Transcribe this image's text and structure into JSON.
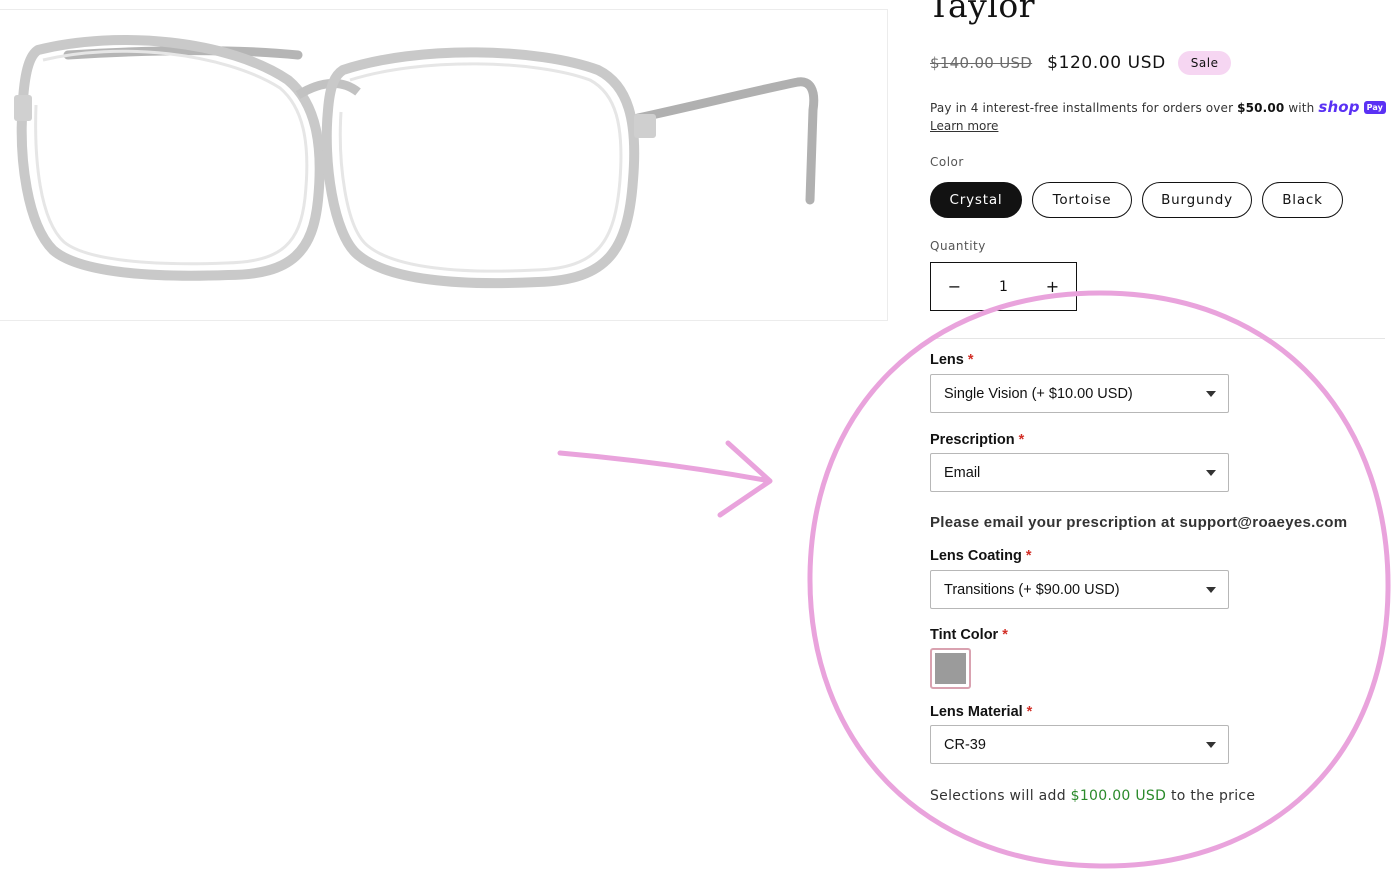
{
  "product": {
    "title": "Taylor",
    "price_original": "$140.00 USD",
    "price_sale": "$120.00 USD",
    "sale_badge": "Sale"
  },
  "installments": {
    "text_before": "Pay in 4 interest-free installments for orders over ",
    "threshold": "$50.00",
    "text_with": " with ",
    "brand": "shop",
    "brand_badge": "Pay",
    "learn_more": "Learn more"
  },
  "color": {
    "label": "Color",
    "options": [
      "Crystal",
      "Tortoise",
      "Burgundy",
      "Black"
    ],
    "selected": "Crystal"
  },
  "quantity": {
    "label": "Quantity",
    "value": "1",
    "minus": "−",
    "plus": "+"
  },
  "options": {
    "lens": {
      "label": "Lens",
      "required": "*",
      "value": "Single Vision (+ $10.00 USD)"
    },
    "prescription": {
      "label": "Prescription",
      "required": "*",
      "value": "Email"
    },
    "email_note": "Please email your prescription at support@roaeyes.com",
    "lens_coating": {
      "label": "Lens Coating",
      "required": "*",
      "value": "Transitions (+ $90.00 USD)"
    },
    "tint_color": {
      "label": "Tint Color",
      "required": "*",
      "swatch_color": "#9b9b9b"
    },
    "lens_material": {
      "label": "Lens Material",
      "required": "*",
      "value": "CR-39"
    }
  },
  "summary": {
    "before": "Selections will add ",
    "amount": "$100.00 USD",
    "after": " to the price"
  },
  "colors": {
    "annotation": "#e9a3dc",
    "accent_green": "#2a8a2a",
    "required_red": "#d22f27",
    "sale_badge_bg": "#f6d6f2",
    "shop_purple": "#5a31f4"
  }
}
